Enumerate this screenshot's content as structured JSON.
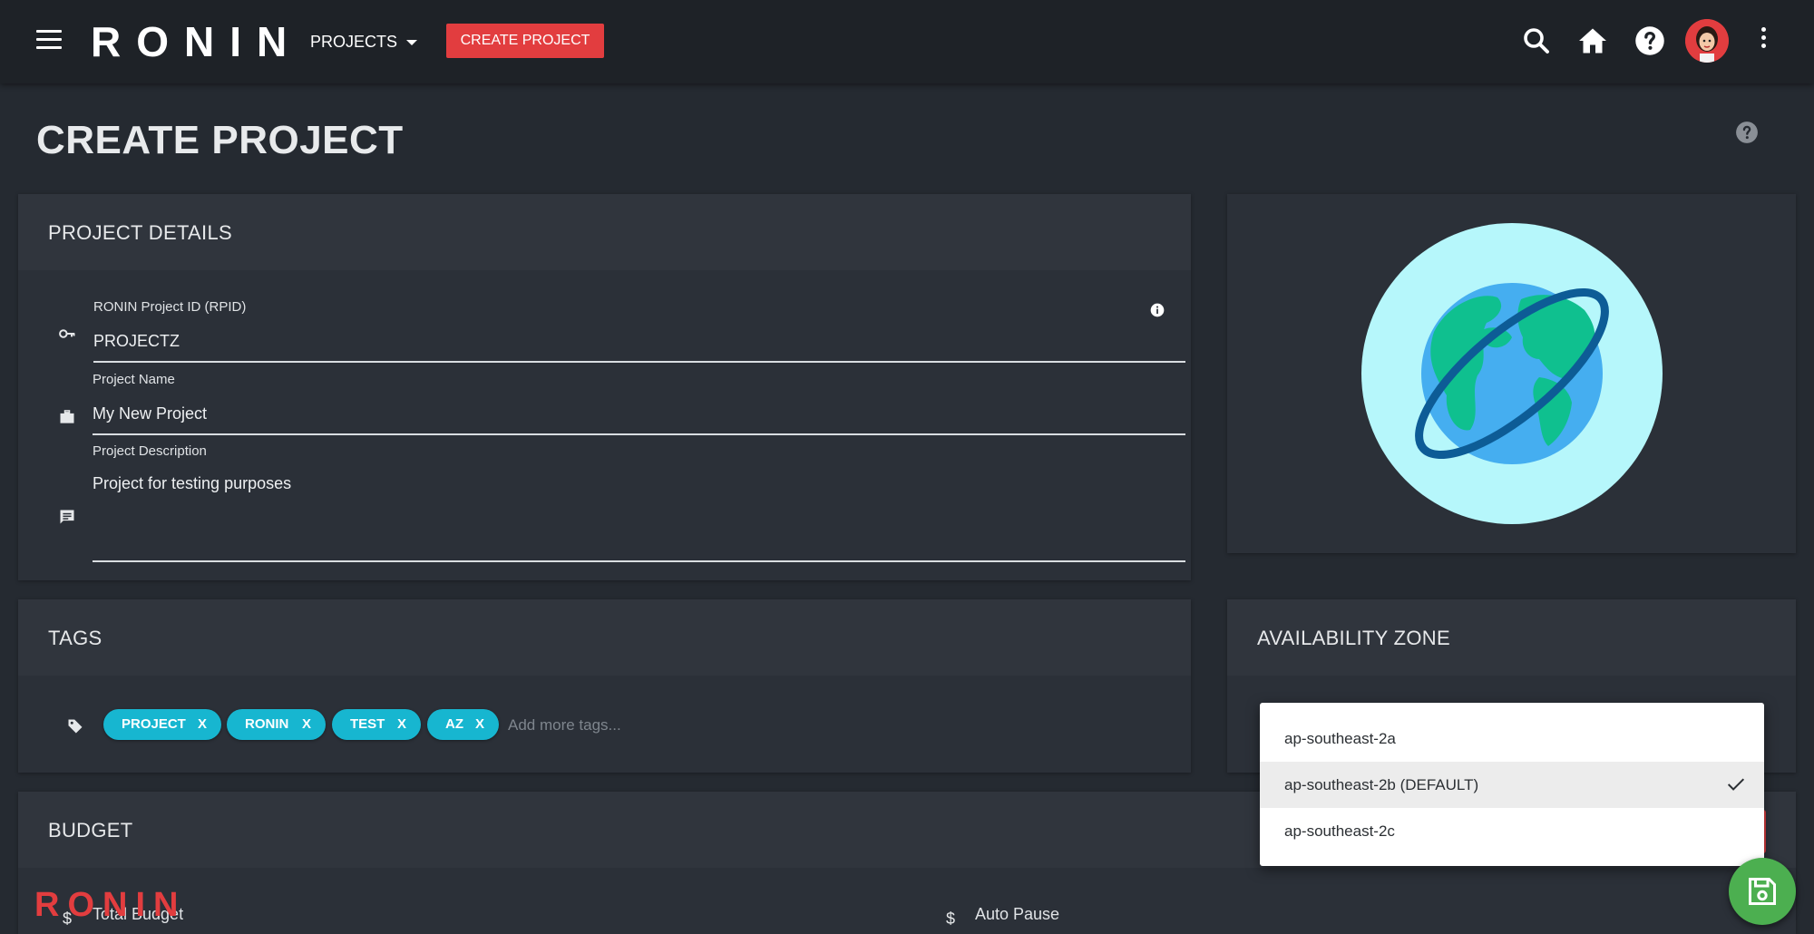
{
  "appbar": {
    "logo_text": "RONIN",
    "projects_menu_label": "PROJECTS",
    "create_button_label": "CREATE PROJECT"
  },
  "page": {
    "title": "CREATE PROJECT"
  },
  "project_details": {
    "heading": "PROJECT DETAILS",
    "rpid_label": "RONIN Project ID (RPID)",
    "rpid_value": "PROJECTZ",
    "name_label": "Project Name",
    "name_value": "My New Project",
    "description_label": "Project Description",
    "description_value": "Project for testing purposes"
  },
  "tags": {
    "heading": "TAGS",
    "chips": [
      {
        "label": "PROJECT",
        "remove": "X"
      },
      {
        "label": "RONIN",
        "remove": "X"
      },
      {
        "label": "TEST",
        "remove": "X"
      },
      {
        "label": "AZ",
        "remove": "X"
      }
    ],
    "input_placeholder": "Add more tags..."
  },
  "availability_zone": {
    "heading": "AVAILABILITY ZONE",
    "options": [
      {
        "label": "ap-southeast-2a",
        "selected": false
      },
      {
        "label": "ap-southeast-2b (DEFAULT)",
        "selected": true
      },
      {
        "label": "ap-southeast-2c",
        "selected": false
      }
    ]
  },
  "budget": {
    "heading": "BUDGET",
    "total_budget_label": "Total Budget",
    "auto_pause_label": "Auto Pause"
  },
  "watermark_text": "RONIN",
  "colors": {
    "accent_red": "#e23d3f",
    "chip_cyan": "#17b6d0",
    "fab_green": "#4caf50",
    "background": "#252a31"
  },
  "icons": {
    "menu": "menu-icon",
    "search": "search-icon",
    "home": "home-icon",
    "help": "help-icon",
    "more": "more-vert-icon",
    "key": "key-icon",
    "briefcase": "briefcase-icon",
    "comment": "comment-icon",
    "tag": "tag-icon",
    "dollar": "dollar-icon",
    "save": "save-icon",
    "info": "info-icon",
    "check": "check-icon"
  }
}
